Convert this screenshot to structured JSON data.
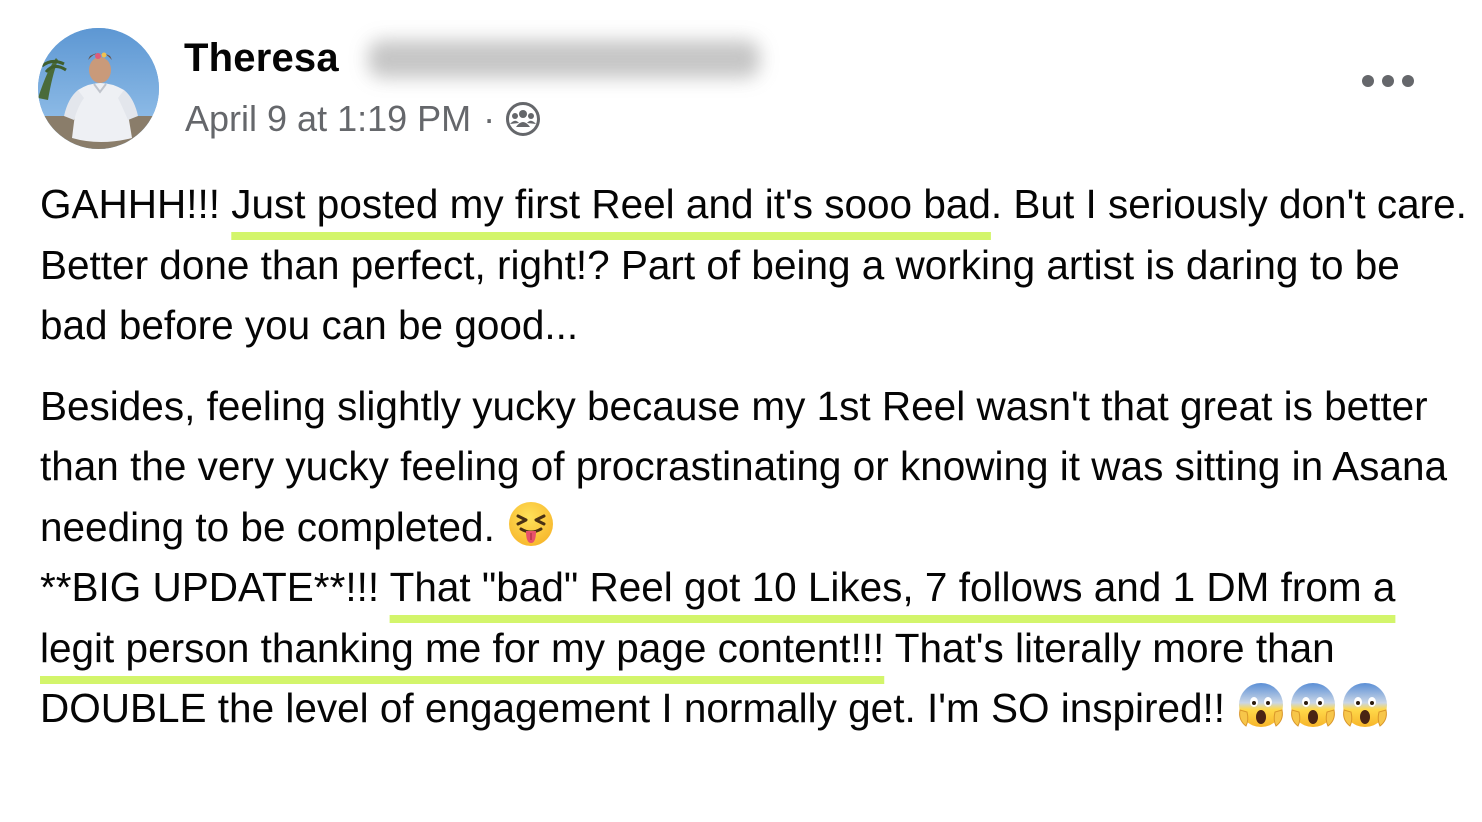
{
  "author": {
    "first_name": "Theresa",
    "avatar_icon": "profile-photo"
  },
  "meta": {
    "timestamp": "April 9 at 1:19 PM",
    "separator": "·",
    "audience_icon": "group-audience-icon"
  },
  "actions": {
    "more_icon": "more-options-icon"
  },
  "post": {
    "p1": {
      "t1": "GAHHH!!! ",
      "h1": "Just posted my first Reel and it's sooo bad",
      "t2": ". But I seriously don't care. Better done than perfect, right!? Part of being a working artist is daring to be bad before you can be good..."
    },
    "p2": {
      "t1": "Besides, feeling slightly yucky because my 1st Reel wasn't that great is better than the very yucky feeling of procrastinating or knowing it was sitting in Asana needing to be completed. ",
      "emoji1": "squinting-face-with-tongue",
      "t2": "**BIG UPDATE**!!! ",
      "h1": "That \"bad\" Reel got 10 Likes, 7 follows and 1 DM from a legit person thanking me for my page content!!!",
      "t3": " That's literally more than DOUBLE the level of engagement I normally get. I'm SO inspired!! ",
      "emoji2": "face-screaming-in-fear",
      "emoji2_count": 3
    }
  },
  "colors": {
    "text": "#050505",
    "secondary": "#65676b",
    "highlight": "#d3f56b"
  }
}
